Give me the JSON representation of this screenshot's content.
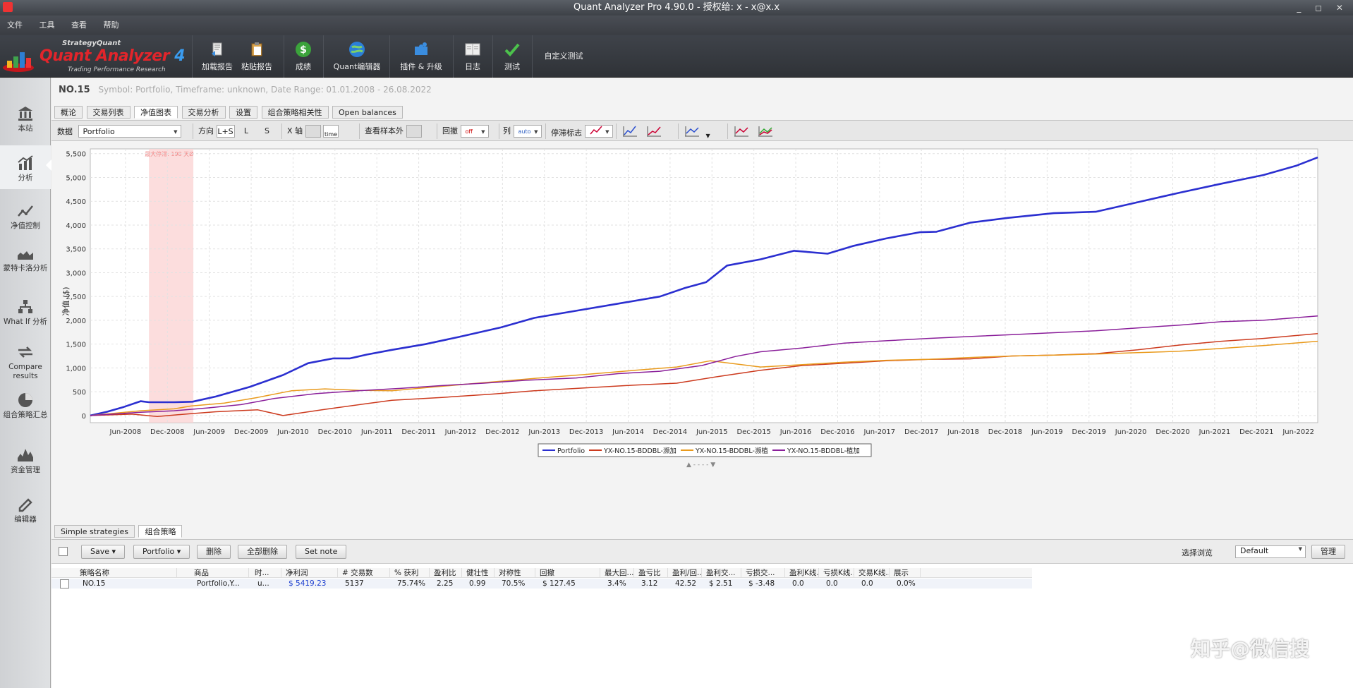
{
  "window": {
    "title": "Quant Analyzer Pro 4.90.0 - 授权给: x - x@x.x",
    "controls": "_ ◻ ✕"
  },
  "menu": [
    "文件",
    "工具",
    "查看",
    "帮助"
  ],
  "logo": {
    "top": "StrategyQuant",
    "main": "Quant Analyzer",
    "version": "4",
    "sub": "Trading Performance    Research"
  },
  "toolbar": [
    {
      "label": "加载报告",
      "icon": "load-report-icon"
    },
    {
      "label": "粘贴报告",
      "icon": "paste-report-icon"
    },
    {
      "label": "成绩",
      "icon": "dollar-icon"
    },
    {
      "label": "Quant编辑器",
      "icon": "globe-icon"
    },
    {
      "label": "插件 & 升级",
      "icon": "puzzle-icon"
    },
    {
      "label": "日志",
      "icon": "log-icon"
    },
    {
      "label": "测试",
      "icon": "check-icon"
    },
    {
      "label": "自定义测试",
      "icon": ""
    }
  ],
  "sidebar": [
    {
      "label": "本站",
      "icon": "bank-icon"
    },
    {
      "label": "分析",
      "icon": "analysis-chart-icon",
      "active": true
    },
    {
      "label": "净值控制",
      "icon": "equity-control-icon"
    },
    {
      "label": "蒙特卡洛分析",
      "icon": "monte-carlo-icon"
    },
    {
      "label": "What If 分析",
      "icon": "what-if-icon"
    },
    {
      "label": "Compare results",
      "icon": "compare-arrows-icon"
    },
    {
      "label": "组合策略汇总",
      "icon": "pie-icon"
    },
    {
      "label": "资金管理",
      "icon": "money-mgmt-icon"
    },
    {
      "label": "编辑器",
      "icon": "edit-icon"
    }
  ],
  "header": {
    "name": "NO.15",
    "info": "Symbol: Portfolio, Timeframe: unknown, Date Range: 01.01.2008 - 26.08.2022"
  },
  "tabs": [
    "概论",
    "交易列表",
    "净值图表",
    "交易分析",
    "设置",
    "组合策略相关性",
    "Open balances"
  ],
  "active_tab": 2,
  "chart_controls": {
    "data_label": "数据",
    "data_value": "Portfolio",
    "direction_label": "方向",
    "dir_ls": "L+S",
    "dir_l": "L",
    "dir_s": "S",
    "xaxis_label": "X 轴",
    "xaxis_time": "time",
    "oos_label": "查看样本外",
    "drawdown_label": "回撤",
    "drawdown_value": "off",
    "column_label": "列",
    "column_value": "auto",
    "stagnation_label": "停滞标志"
  },
  "chart_data": {
    "type": "line",
    "ylabel": "净值 ($)",
    "ylim": [
      -150,
      5600
    ],
    "yticks": [
      0,
      500,
      1000,
      1500,
      2000,
      2500,
      3000,
      3500,
      4000,
      4500,
      5000,
      5500
    ],
    "ytick_labels": [
      "0",
      "500",
      "1,000",
      "1,500",
      "2,000",
      "2,500",
      "3,000",
      "3,500",
      "4,000",
      "4,500",
      "5,000",
      "5,500"
    ],
    "xlim": [
      2008.0,
      2022.65
    ],
    "xtick_labels": [
      "Jun-2008",
      "Dec-2008",
      "Jun-2009",
      "Dec-2009",
      "Jun-2010",
      "Dec-2010",
      "Jun-2011",
      "Dec-2011",
      "Jun-2012",
      "Dec-2012",
      "Jun-2013",
      "Dec-2013",
      "Jun-2014",
      "Dec-2014",
      "Jun-2015",
      "Dec-2015",
      "Jun-2016",
      "Dec-2016",
      "Jun-2017",
      "Dec-2017",
      "Jun-2018",
      "Dec-2018",
      "Jun-2019",
      "Dec-2019",
      "Jun-2020",
      "Dec-2020",
      "Jun-2021",
      "Dec-2021",
      "Jun-2022"
    ],
    "xtick_values": [
      2008.42,
      2008.92,
      2009.42,
      2009.92,
      2010.42,
      2010.92,
      2011.42,
      2011.92,
      2012.42,
      2012.92,
      2013.42,
      2013.92,
      2014.42,
      2014.92,
      2015.42,
      2015.92,
      2016.42,
      2016.92,
      2017.42,
      2017.92,
      2018.42,
      2018.92,
      2019.42,
      2019.92,
      2020.42,
      2020.92,
      2021.42,
      2021.92,
      2022.42
    ],
    "stagnation": {
      "from": 2008.7,
      "to": 2009.23,
      "label": "最大停滞: 198 天Ø"
    },
    "grid": true,
    "legend_position": "bottom-center",
    "series": [
      {
        "name": "Portfolio",
        "color": "#2b2fd0",
        "x": [
          2008.0,
          2008.2,
          2008.4,
          2008.6,
          2008.7,
          2009.0,
          2009.22,
          2009.5,
          2009.9,
          2010.3,
          2010.6,
          2010.9,
          2011.1,
          2011.3,
          2011.6,
          2012.0,
          2012.4,
          2012.9,
          2013.3,
          2013.8,
          2014.3,
          2014.8,
          2015.1,
          2015.35,
          2015.6,
          2016.0,
          2016.4,
          2016.8,
          2017.1,
          2017.5,
          2017.9,
          2018.1,
          2018.5,
          2018.95,
          2019.5,
          2020.0,
          2020.5,
          2021.0,
          2021.5,
          2022.0,
          2022.4,
          2022.65
        ],
        "y": [
          0,
          80,
          180,
          300,
          280,
          280,
          290,
          400,
          600,
          850,
          1100,
          1200,
          1200,
          1280,
          1380,
          1500,
          1650,
          1850,
          2050,
          2200,
          2350,
          2500,
          2680,
          2800,
          3150,
          3280,
          3460,
          3400,
          3560,
          3720,
          3850,
          3860,
          4050,
          4150,
          4250,
          4280,
          4480,
          4680,
          4870,
          5050,
          5250,
          5420
        ]
      },
      {
        "name": "YX-NO.15-BDDBL-濒加",
        "color": "#cc3a1e",
        "x": [
          2008.0,
          2008.5,
          2008.8,
          2009.2,
          2009.5,
          2010.0,
          2010.3,
          2010.8,
          2011.3,
          2011.6,
          2012.2,
          2012.8,
          2013.3,
          2013.9,
          2014.5,
          2015.0,
          2015.5,
          2016.0,
          2016.5,
          2017.0,
          2017.5,
          2018.0,
          2018.5,
          2019.0,
          2019.5,
          2020.0,
          2020.5,
          2021.0,
          2021.5,
          2022.0,
          2022.65
        ],
        "y": [
          0,
          30,
          -20,
          40,
          80,
          120,
          0,
          130,
          250,
          320,
          380,
          450,
          520,
          580,
          640,
          680,
          820,
          950,
          1050,
          1100,
          1150,
          1180,
          1190,
          1250,
          1270,
          1300,
          1380,
          1480,
          1560,
          1620,
          1720
        ]
      },
      {
        "name": "YX-NO.15-BDDBL-濒植",
        "color": "#e99a1c",
        "x": [
          2008.0,
          2008.6,
          2009.0,
          2009.2,
          2009.6,
          2010.0,
          2010.4,
          2010.8,
          2011.2,
          2011.6,
          2012.1,
          2012.7,
          2013.3,
          2013.9,
          2014.5,
          2015.0,
          2015.4,
          2016.0,
          2016.5,
          2017.0,
          2017.5,
          2018.0,
          2018.5,
          2019.0,
          2019.5,
          2020.0,
          2020.5,
          2021.0,
          2021.5,
          2022.0,
          2022.65
        ],
        "y": [
          0,
          100,
          140,
          200,
          260,
          380,
          520,
          560,
          530,
          520,
          600,
          690,
          780,
          860,
          950,
          1020,
          1150,
          1020,
          1070,
          1120,
          1160,
          1180,
          1220,
          1250,
          1270,
          1290,
          1320,
          1350,
          1410,
          1470,
          1560
        ]
      },
      {
        "name": "YX-NO.15-BDDBL-植加",
        "color": "#8a1f9a",
        "x": [
          2008.0,
          2008.6,
          2009.0,
          2009.4,
          2009.8,
          2010.2,
          2010.7,
          2011.2,
          2011.7,
          2012.2,
          2012.7,
          2013.2,
          2013.8,
          2014.3,
          2014.8,
          2015.3,
          2015.7,
          2016.0,
          2016.5,
          2017.0,
          2017.5,
          2018.0,
          2018.5,
          2019.0,
          2019.5,
          2020.0,
          2020.5,
          2021.0,
          2021.5,
          2022.0,
          2022.65
        ],
        "y": [
          0,
          70,
          100,
          160,
          230,
          360,
          460,
          520,
          570,
          630,
          680,
          740,
          790,
          880,
          930,
          1050,
          1240,
          1340,
          1420,
          1520,
          1570,
          1620,
          1660,
          1700,
          1740,
          1780,
          1840,
          1900,
          1970,
          2000,
          2090
        ]
      }
    ]
  },
  "bottom_tabs": [
    "Simple strategies",
    "组合策略"
  ],
  "bottom_active": 1,
  "bottom_toolbar": {
    "save": "Save",
    "portfolio": "Portfolio",
    "delete": "删除",
    "delete_all": "全部删除",
    "set_note": "Set note",
    "view_label": "选择浏览",
    "view_value": "Default",
    "manage": "管理"
  },
  "table": {
    "headers": [
      "策略名称",
      "商品",
      "时...",
      "净利润",
      "# 交易数",
      "% 获利",
      "盈利比",
      "健壮性",
      "对称性",
      "回撤",
      "最大回...",
      "盈亏比",
      "盈利/回...",
      "盈利交...",
      "亏损交...",
      "盈利K线...",
      "亏损K线...",
      "交易K线...",
      "展示"
    ],
    "rows": [
      [
        "NO.15",
        "Portfolio,Y...",
        "u...",
        "$ 5419.23",
        "5137",
        "75.74%",
        "2.25",
        "0.99",
        "70.5%",
        "$ 127.45",
        "3.4%",
        "3.12",
        "42.52",
        "$ 2.51",
        "$ -3.48",
        "0.0",
        "0.0",
        "0.0",
        "0.0%"
      ]
    ]
  },
  "watermark": "知乎@微信搜"
}
